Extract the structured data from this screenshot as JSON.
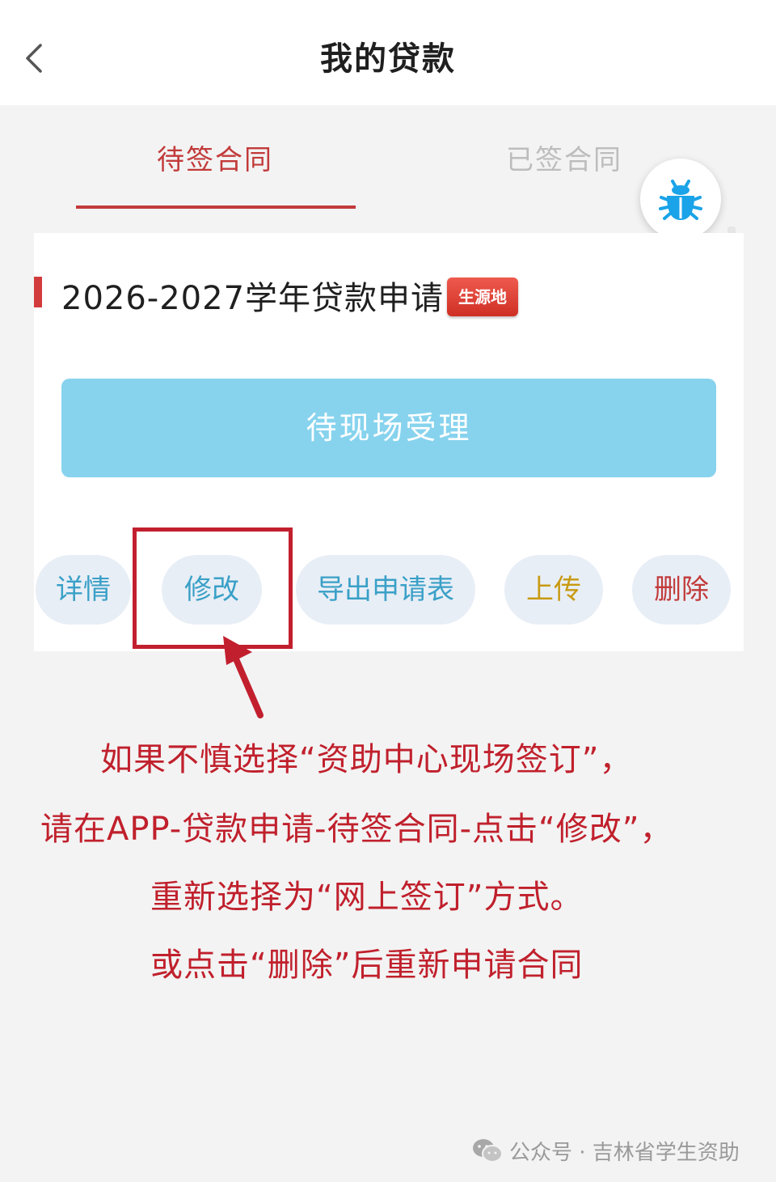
{
  "header": {
    "title": "我的贷款",
    "back_icon": "chevron-left-icon"
  },
  "tabs": [
    {
      "label": "待签合同",
      "active": true
    },
    {
      "label": "已签合同",
      "active": false
    }
  ],
  "floating_button": {
    "icon": "bug-icon"
  },
  "card": {
    "title": "2026-2027学年贷款申请",
    "badge": "生源地",
    "status_button": "待现场受理",
    "actions": {
      "detail": "详情",
      "edit": "修改",
      "export": "导出申请表",
      "upload": "上传",
      "delete": "删除"
    }
  },
  "annotation": {
    "lines": [
      "如果不慎选择“资助中心现场签订”，",
      "请在APP-贷款申请-待签合同-点击“修改”，",
      "重新选择为“网上签订”方式。",
      "或点击“删除”后重新申请合同"
    ]
  },
  "watermark": {
    "text": "公众号 · 吉林省学生资助",
    "icon": "wechat-icon"
  },
  "colors": {
    "accent_red": "#c23a3a",
    "status_blue": "#87d3ee",
    "annotation_red": "#c0202c"
  }
}
